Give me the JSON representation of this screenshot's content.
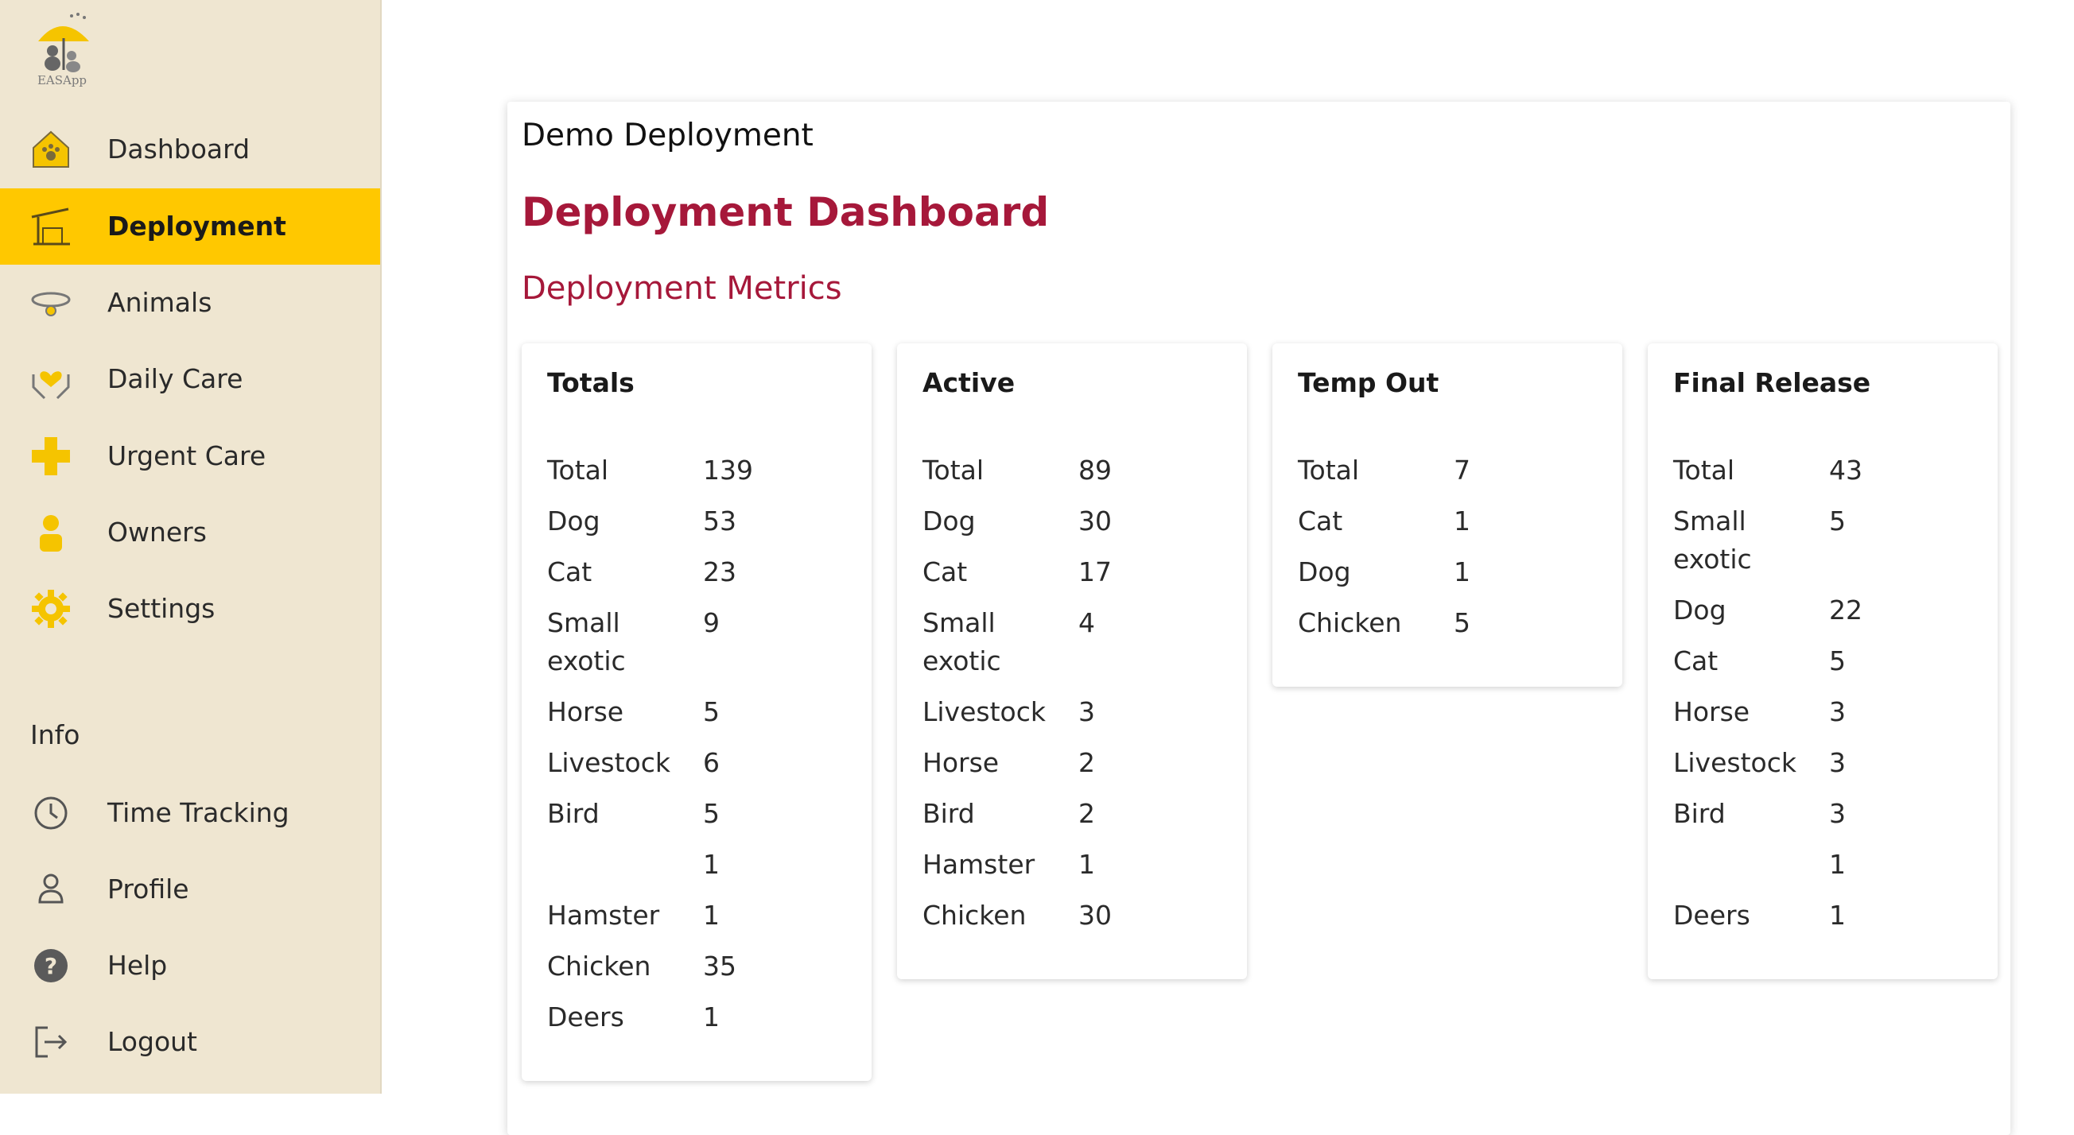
{
  "app": {
    "logo_text": "EASApp"
  },
  "sidebar": {
    "items": [
      {
        "label": "Dashboard",
        "icon": "house-paw-icon",
        "active": false
      },
      {
        "label": "Deployment",
        "icon": "deployment-shelter-icon",
        "active": true
      },
      {
        "label": "Animals",
        "icon": "collar-icon",
        "active": false
      },
      {
        "label": "Daily Care",
        "icon": "heart-hands-icon",
        "active": false
      },
      {
        "label": "Urgent Care",
        "icon": "medical-cross-icon",
        "active": false
      },
      {
        "label": "Owners",
        "icon": "person-icon",
        "active": false
      },
      {
        "label": "Settings",
        "icon": "gear-icon",
        "active": false
      }
    ],
    "info_label": "Info",
    "info_items": [
      {
        "label": "Time Tracking",
        "icon": "clock-icon"
      },
      {
        "label": "Profile",
        "icon": "profile-icon"
      },
      {
        "label": "Help",
        "icon": "help-icon"
      },
      {
        "label": "Logout",
        "icon": "logout-icon"
      }
    ]
  },
  "main": {
    "deployment_name": "Demo Deployment",
    "title": "Deployment Dashboard",
    "metrics_title": "Deployment Metrics",
    "cards": [
      {
        "title": "Totals",
        "rows": [
          {
            "k": "Total",
            "v": "139"
          },
          {
            "k": "Dog",
            "v": "53"
          },
          {
            "k": "Cat",
            "v": "23"
          },
          {
            "k": "Small exotic",
            "v": "9"
          },
          {
            "k": "Horse",
            "v": "5"
          },
          {
            "k": "Livestock",
            "v": "6"
          },
          {
            "k": "Bird",
            "v": "5"
          },
          {
            "k": "",
            "v": "1"
          },
          {
            "k": "Hamster",
            "v": "1"
          },
          {
            "k": "Chicken",
            "v": "35"
          },
          {
            "k": "Deers",
            "v": "1"
          }
        ]
      },
      {
        "title": "Active",
        "rows": [
          {
            "k": "Total",
            "v": "89"
          },
          {
            "k": "Dog",
            "v": "30"
          },
          {
            "k": "Cat",
            "v": "17"
          },
          {
            "k": "Small exotic",
            "v": "4"
          },
          {
            "k": "Livestock",
            "v": "3"
          },
          {
            "k": "Horse",
            "v": "2"
          },
          {
            "k": "Bird",
            "v": "2"
          },
          {
            "k": "Hamster",
            "v": "1"
          },
          {
            "k": "Chicken",
            "v": "30"
          }
        ]
      },
      {
        "title": "Temp Out",
        "rows": [
          {
            "k": "Total",
            "v": "7"
          },
          {
            "k": "Cat",
            "v": "1"
          },
          {
            "k": "Dog",
            "v": "1"
          },
          {
            "k": "Chicken",
            "v": "5"
          }
        ]
      },
      {
        "title": "Final Release",
        "rows": [
          {
            "k": "Total",
            "v": "43"
          },
          {
            "k": "Small exotic",
            "v": "5"
          },
          {
            "k": "Dog",
            "v": "22"
          },
          {
            "k": "Cat",
            "v": "5"
          },
          {
            "k": "Horse",
            "v": "3"
          },
          {
            "k": "Livestock",
            "v": "3"
          },
          {
            "k": "Bird",
            "v": "3"
          },
          {
            "k": "",
            "v": "1"
          },
          {
            "k": "Deers",
            "v": "1"
          }
        ]
      }
    ]
  },
  "colors": {
    "sidebar_bg": "#efe6d1",
    "active_bg": "#ffc800",
    "accent_red": "#a6183a",
    "icon_yellow": "#f5c400"
  }
}
